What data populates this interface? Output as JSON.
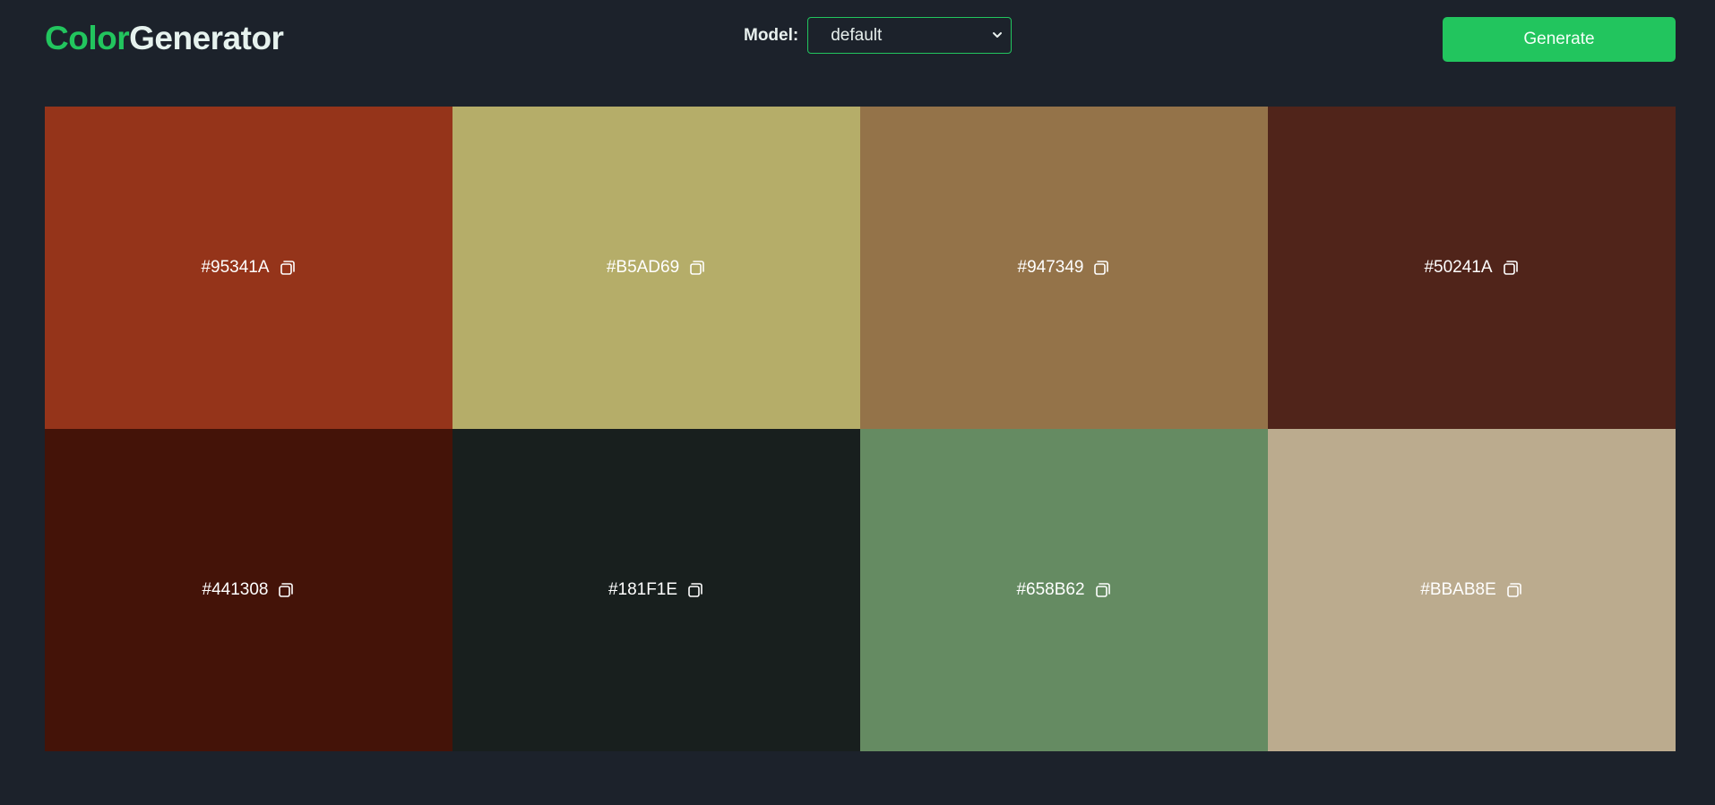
{
  "app": {
    "logo_part_a": "Color",
    "logo_part_b": "Generator"
  },
  "controls": {
    "model_label": "Model:",
    "model_value": "default",
    "generate_label": "Generate"
  },
  "swatches": [
    {
      "hex": "#95341A",
      "color": "#95341A"
    },
    {
      "hex": "#B5AD69",
      "color": "#B5AD69"
    },
    {
      "hex": "#947349",
      "color": "#947349"
    },
    {
      "hex": "#50241A",
      "color": "#50241A"
    },
    {
      "hex": "#441308",
      "color": "#441308"
    },
    {
      "hex": "#181F1E",
      "color": "#181F1E"
    },
    {
      "hex": "#658B62",
      "color": "#658B62"
    },
    {
      "hex": "#BBAB8E",
      "color": "#BBAB8E"
    }
  ],
  "icons": {
    "copy": "copy-icon",
    "dropdown": "chevron-down-icon"
  },
  "colors": {
    "accent": "#22c55e",
    "background": "#1c222b"
  }
}
